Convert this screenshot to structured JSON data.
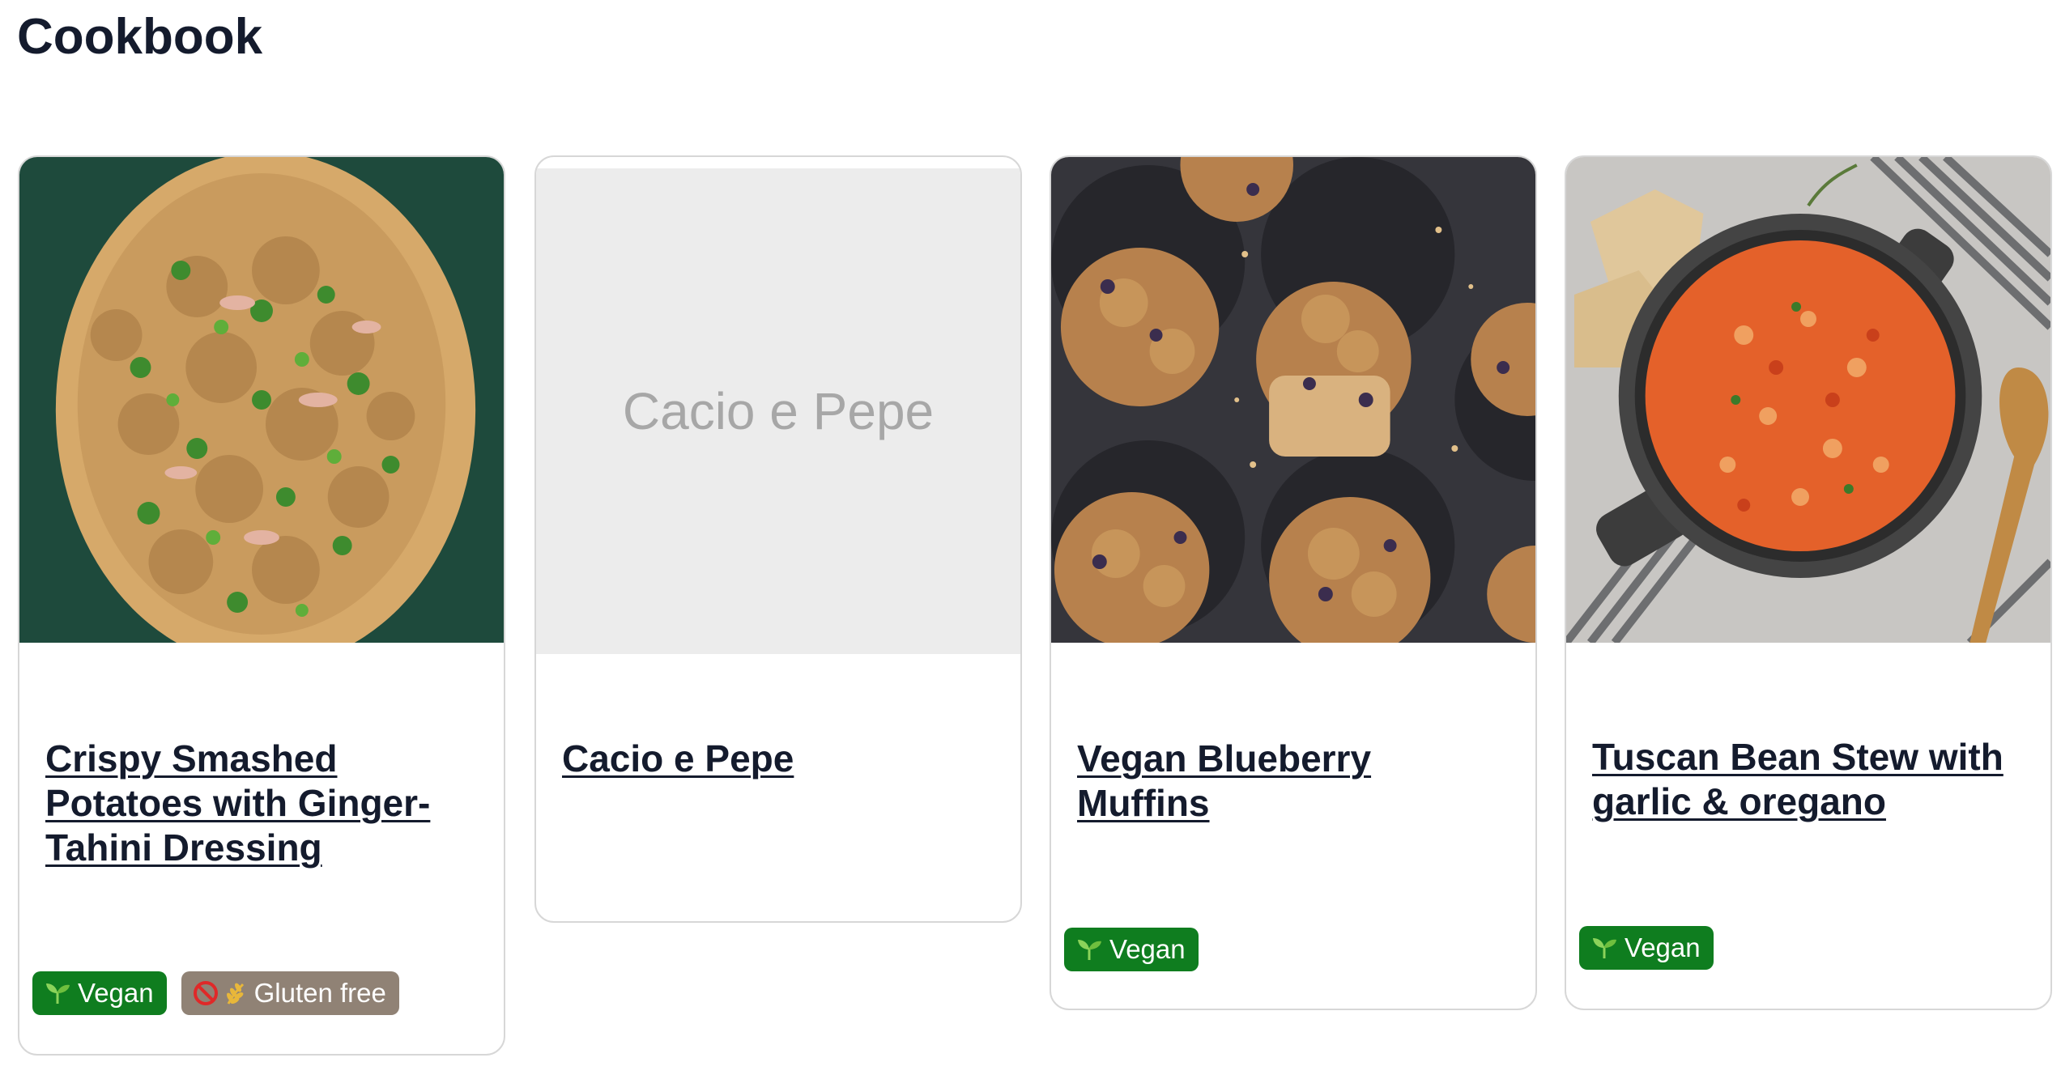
{
  "page": {
    "title": "Cookbook"
  },
  "colors": {
    "vegan_tag": "#0f7d1f",
    "gluten_free_tag": "#908275",
    "placeholder_bg": "#ececec",
    "placeholder_text": "#a7a7a7",
    "title_text": "#141b2d",
    "card_border": "#d7d7d7"
  },
  "recipes": [
    {
      "title": "Crispy Smashed Potatoes with Ginger-Tahini Dressing",
      "image": "smashed potatoes with herbs and dressing on an oval platter",
      "tags": [
        {
          "label": "Vegan",
          "icon": "seedling-icon"
        },
        {
          "label": "Gluten free",
          "icon": "no-wheat-icon"
        }
      ]
    },
    {
      "title": "Cacio e Pepe",
      "image_placeholder": "Cacio e Pepe",
      "tags": []
    },
    {
      "title": "Vegan Blueberry Muffins",
      "image": "crumb-topped blueberry muffins in a muffin tin",
      "tags": [
        {
          "label": "Vegan",
          "icon": "seedling-icon"
        }
      ]
    },
    {
      "title": "Tuscan Bean Stew with garlic & oregano",
      "image": "tomato bean stew in a dark pot with bread and wooden spoon",
      "tags": [
        {
          "label": "Vegan",
          "icon": "seedling-icon"
        }
      ]
    }
  ]
}
